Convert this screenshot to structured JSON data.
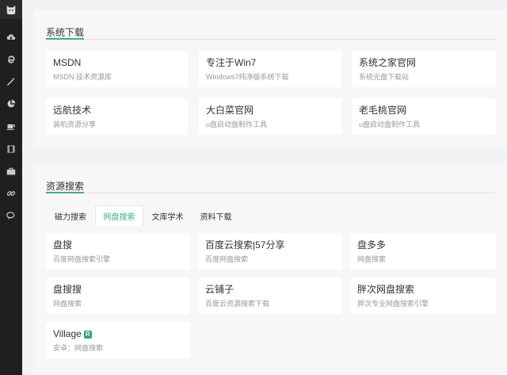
{
  "sidebar": {
    "logo": "cat-logo-icon",
    "items": [
      {
        "icon": "cloud-download-icon"
      },
      {
        "icon": "browser-e-icon"
      },
      {
        "icon": "magic-wand-icon"
      },
      {
        "icon": "pie-chart-icon"
      },
      {
        "icon": "coffee-cup-icon"
      },
      {
        "icon": "film-icon"
      },
      {
        "icon": "briefcase-icon"
      },
      {
        "icon": "link-icon"
      },
      {
        "icon": "chat-icon"
      }
    ]
  },
  "colors": {
    "accent": "#3db27c",
    "sidebar_bg": "#1f1f1f",
    "badge": "#2fa36b"
  },
  "system_download": {
    "title": "系统下载",
    "cards": [
      {
        "title": "MSDN",
        "desc": "MSDN 技术资源库"
      },
      {
        "title": "专注于Win7",
        "desc": "Windows7纯净版系统下载"
      },
      {
        "title": "系统之家官网",
        "desc": "系统光盘下载站"
      },
      {
        "title": "远航技术",
        "desc": "装机资源分享"
      },
      {
        "title": "大白菜官网",
        "desc": "u盘启动盘制作工具"
      },
      {
        "title": "老毛桃官网",
        "desc": "u盘启动盘制作工具"
      }
    ]
  },
  "resource_search": {
    "title": "资源搜索",
    "tabs": [
      {
        "label": "磁力搜索",
        "active": false
      },
      {
        "label": "网盘搜索",
        "active": true
      },
      {
        "label": "文库学术",
        "active": false
      },
      {
        "label": "资料下载",
        "active": false
      }
    ],
    "cards": [
      {
        "title": "盘搜",
        "desc": "百度网盘搜索引擎"
      },
      {
        "title": "百度云搜索|57分享",
        "desc": "百度网盘搜索"
      },
      {
        "title": "盘多多",
        "desc": "网盘搜索"
      },
      {
        "title": "盘搜搜",
        "desc": "网盘搜索"
      },
      {
        "title": "云铺子",
        "desc": "百度云资源搜索下载"
      },
      {
        "title": "胖次网盘搜索",
        "desc": "胖次专业网盘搜索引擎"
      },
      {
        "title": "Village",
        "badge": "R",
        "desc": "安卓：网盘搜索"
      }
    ]
  }
}
